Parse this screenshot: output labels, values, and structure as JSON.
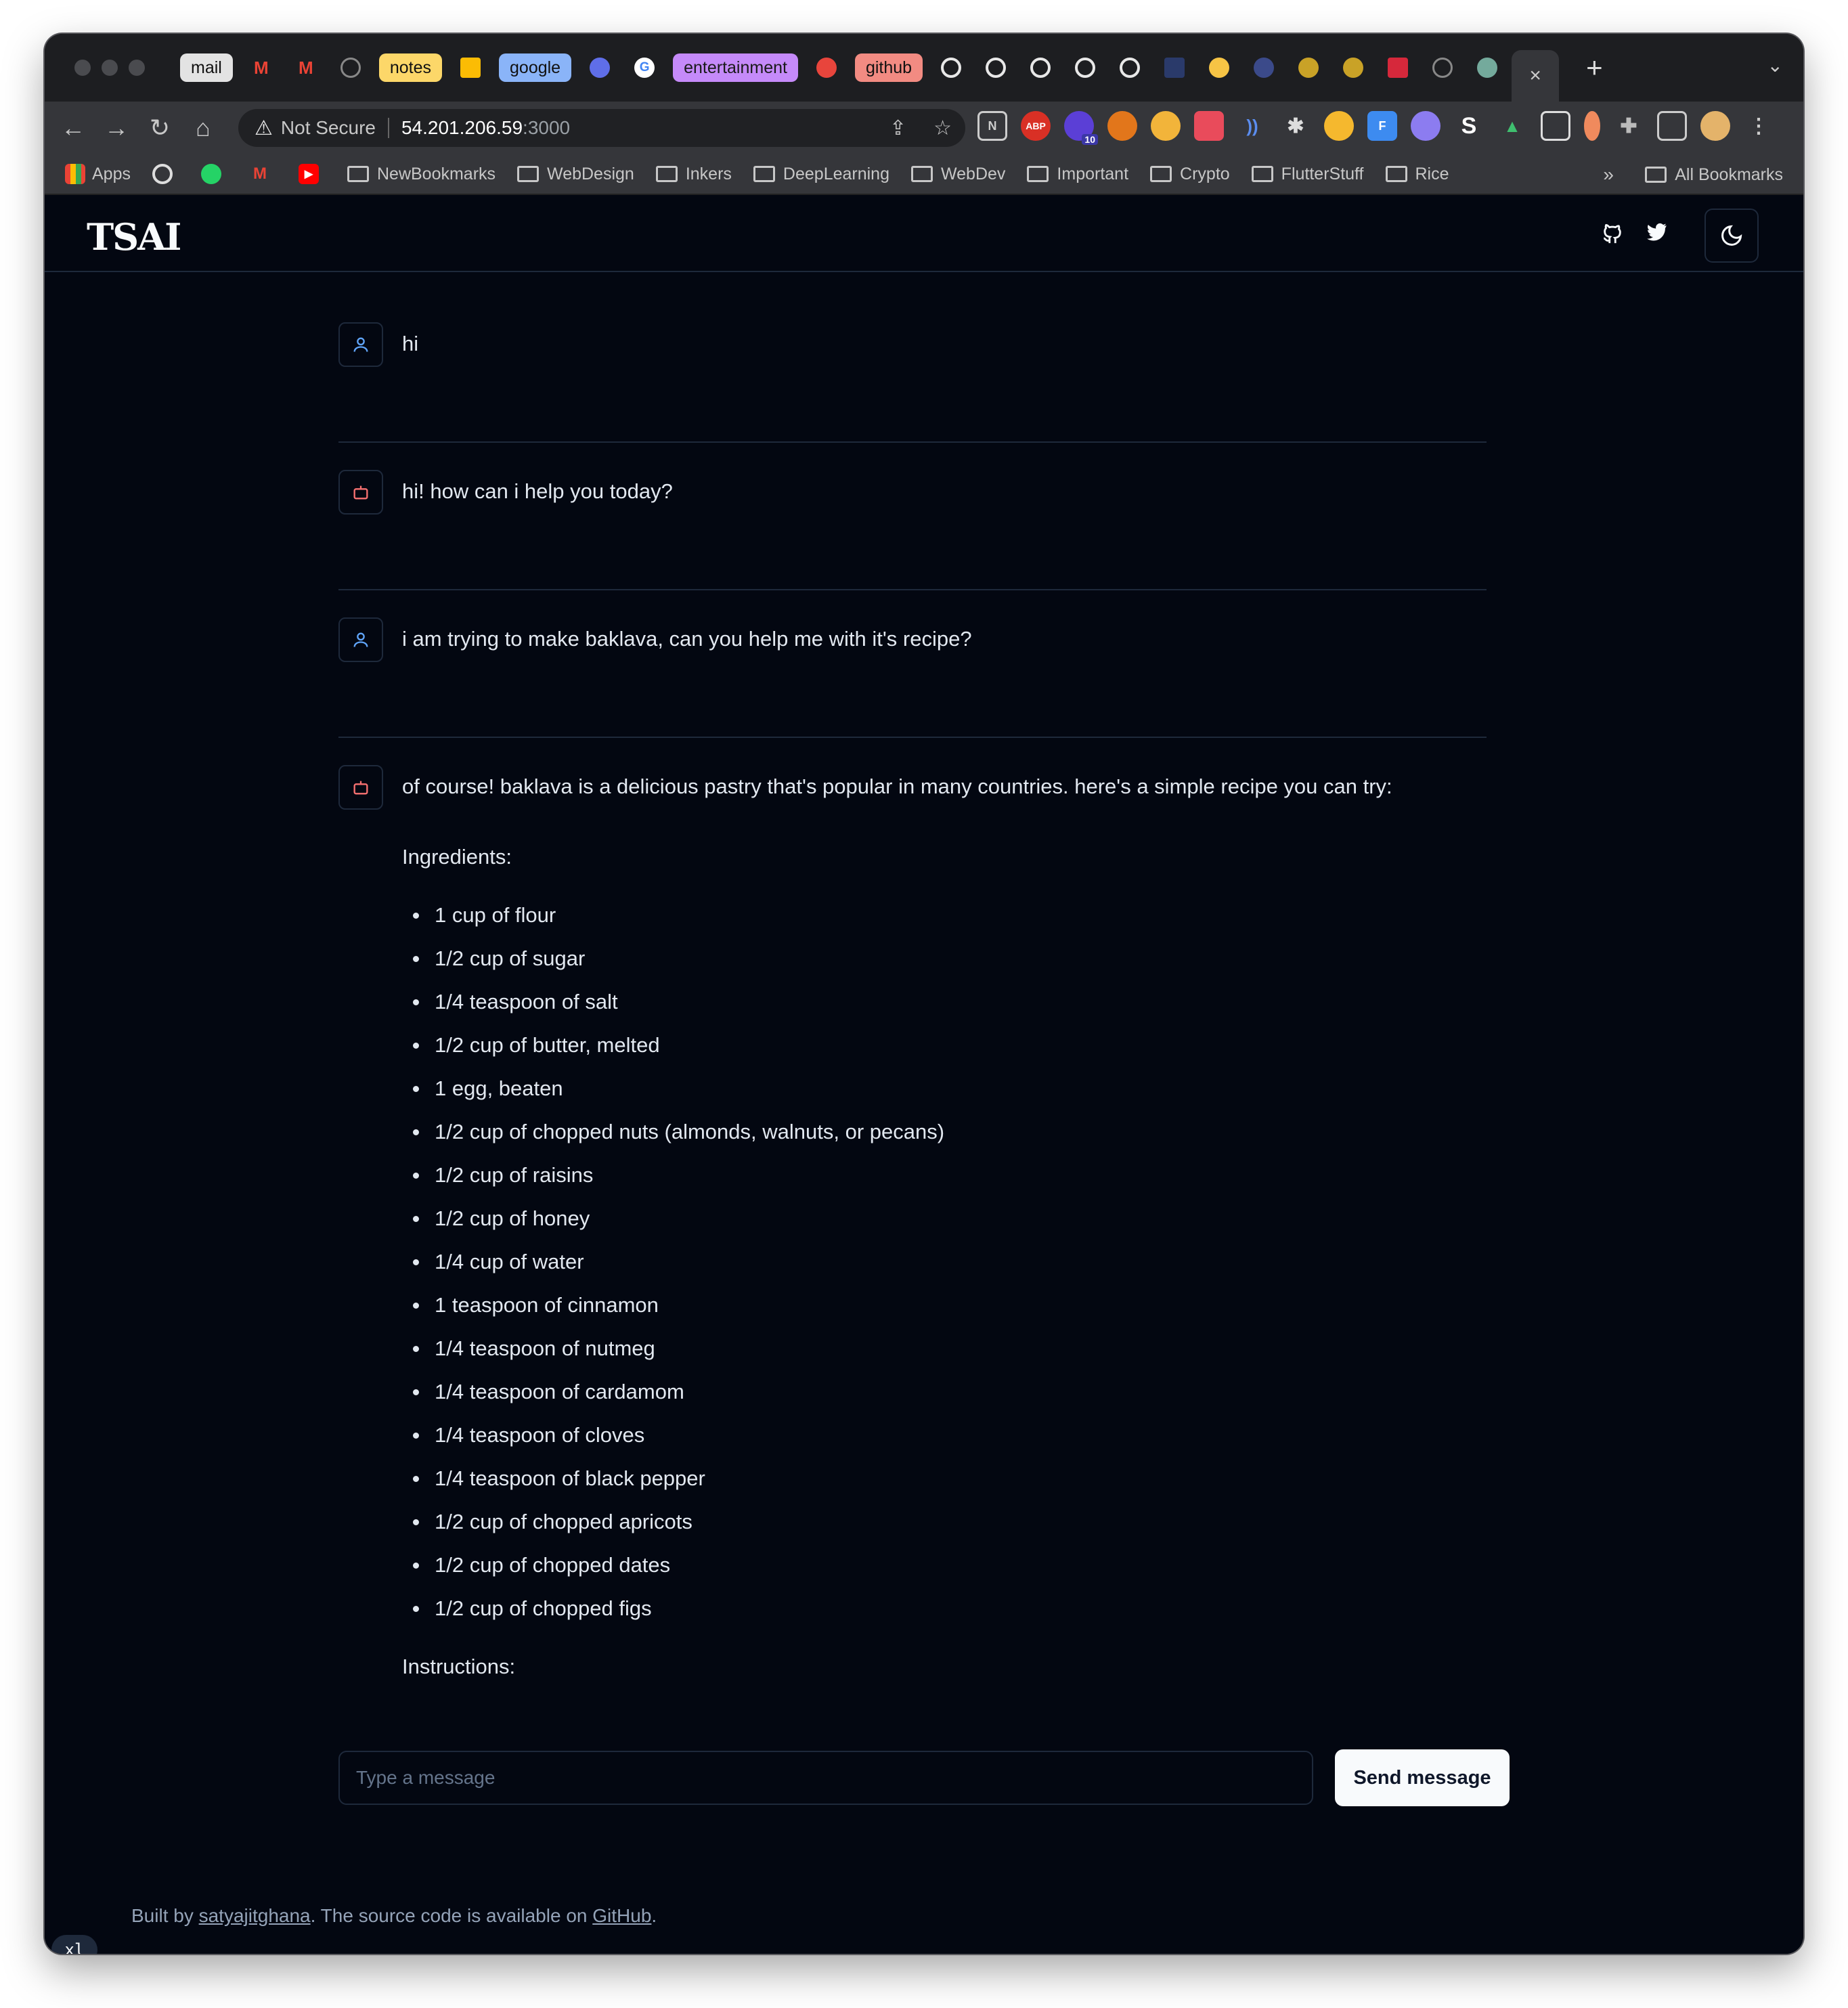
{
  "browser": {
    "tab_groups": [
      {
        "label": "mail",
        "color": "#e3e3e3"
      },
      {
        "label": "notes",
        "color": "#fcd769"
      },
      {
        "label": "google",
        "color": "#8ab4f8"
      },
      {
        "label": "entertainment",
        "color": "#c58af9"
      },
      {
        "label": "github",
        "color": "#f28b82"
      }
    ],
    "address": {
      "security_label": "Not Secure",
      "host": "54.201.206.59",
      "port": ":3000"
    },
    "extensions": [
      "notion-icon",
      "adblock-icon",
      "extension-badge-icon",
      "metamask-icon",
      "extension-icon",
      "extension-icon",
      "extension-icon",
      "settings-icon",
      "extension-icon",
      "extension-icon",
      "extension-icon",
      "extension-icon",
      "extension-icon",
      "extension-icon",
      "extension-icon",
      "puzzle-icon",
      "sidepanel-icon",
      "profile-avatar"
    ],
    "extension_badge": "10",
    "bookmarks": [
      {
        "label": "Apps",
        "type": "apps"
      },
      {
        "label": "",
        "type": "github"
      },
      {
        "label": "",
        "type": "whatsapp"
      },
      {
        "label": "",
        "type": "gmail"
      },
      {
        "label": "",
        "type": "youtube"
      },
      {
        "label": "NewBookmarks",
        "type": "folder"
      },
      {
        "label": "WebDesign",
        "type": "folder"
      },
      {
        "label": "Inkers",
        "type": "folder"
      },
      {
        "label": "DeepLearning",
        "type": "folder"
      },
      {
        "label": "WebDev",
        "type": "folder"
      },
      {
        "label": "Important",
        "type": "folder"
      },
      {
        "label": "Crypto",
        "type": "folder"
      },
      {
        "label": "FlutterStuff",
        "type": "folder"
      },
      {
        "label": "Rice",
        "type": "folder"
      }
    ],
    "overflow": "»",
    "all_bookmarks": "All Bookmarks"
  },
  "app": {
    "logo": "TSAI",
    "header_icons": [
      "github-icon",
      "twitter-icon",
      "moon-icon"
    ]
  },
  "chat": {
    "messages": [
      {
        "role": "user",
        "text": "hi"
      },
      {
        "role": "bot",
        "text": "hi! how can i help you today?"
      },
      {
        "role": "user",
        "text": "i am trying to make baklava, can you help me with it's recipe?"
      }
    ],
    "recipe": {
      "intro": "of course! baklava is a delicious pastry that's popular in many countries. here's a simple recipe you can try:",
      "ingredients_heading": "Ingredients:",
      "ingredients": [
        "1 cup of flour",
        "1/2 cup of sugar",
        "1/4 teaspoon of salt",
        "1/2 cup of butter, melted",
        "1 egg, beaten",
        "1/2 cup of chopped nuts (almonds, walnuts, or pecans)",
        "1/2 cup of raisins",
        "1/2 cup of honey",
        "1/4 cup of water",
        "1 teaspoon of cinnamon",
        "1/4 teaspoon of nutmeg",
        "1/4 teaspoon of cardamom",
        "1/4 teaspoon of cloves",
        "1/4 teaspoon of black pepper",
        "1/2 cup of chopped apricots",
        "1/2 cup of chopped dates",
        "1/2 cup of chopped figs"
      ],
      "instructions_heading": "Instructions:"
    },
    "input_placeholder": "Type a message",
    "send_label": "Send message"
  },
  "footer": {
    "prefix": "Built by ",
    "author": "satyajitghana",
    "middle": ". The source code is available on ",
    "link": "GitHub",
    "suffix": "."
  },
  "breakpoint_badge": "xl",
  "colors": {
    "background": "#030711",
    "border": "#1e293b",
    "user_icon": "#60a5fa",
    "bot_icon": "#f87171"
  }
}
